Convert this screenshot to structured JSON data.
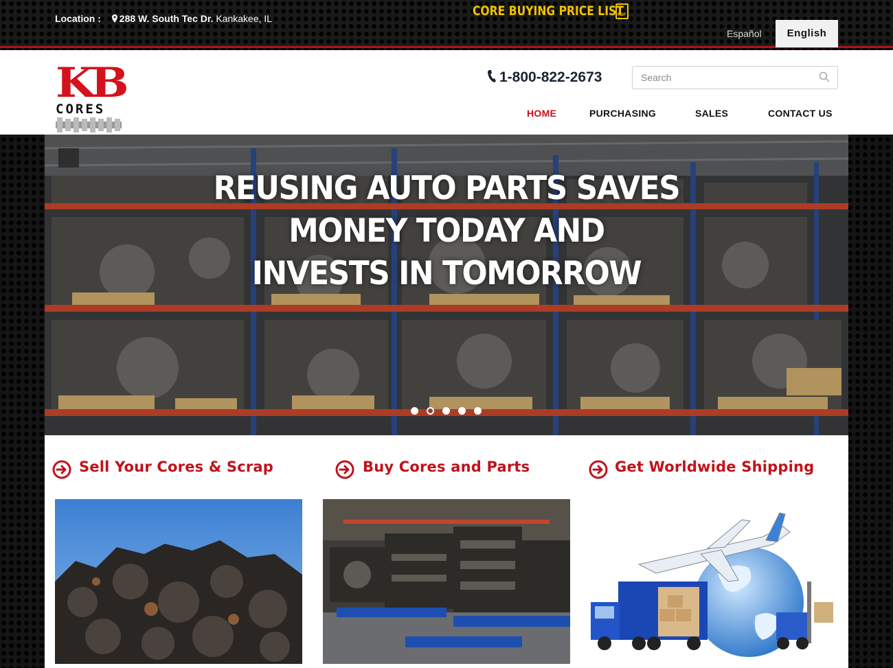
{
  "topbar": {
    "location_label": "Location :",
    "address_street": "288 W. South Tec Dr.",
    "address_city": "Kankakee, IL",
    "price_list_label": "CORE BUYING PRICE LIST",
    "pdf_label": "PDF",
    "languages": [
      "Español",
      "English"
    ],
    "active_language": "English"
  },
  "header": {
    "logo_line1": "KB",
    "logo_line2": "CORES",
    "phone": "1-800-822-2673",
    "search_placeholder": "Search"
  },
  "nav": {
    "items": [
      "HOME",
      "PURCHASING",
      "SALES",
      "CONTACT US"
    ],
    "active": "HOME"
  },
  "slider": {
    "headline": [
      "REUSING AUTO PARTS SAVES",
      "MONEY TODAY AND",
      "INVESTS IN TOMORROW"
    ],
    "slide_count": 5,
    "active_slide": 2
  },
  "columns": [
    {
      "title": "Sell Your Cores & Scrap",
      "image": "scrap-pile"
    },
    {
      "title": "Buy Cores and Parts",
      "image": "engine-cores-warehouse"
    },
    {
      "title": "Get Worldwide Shipping",
      "image": "shipping-globe"
    }
  ],
  "colors": {
    "brand_red": "#c0121b",
    "price_list_yellow": "#f2c200",
    "text_dark": "#111111"
  }
}
